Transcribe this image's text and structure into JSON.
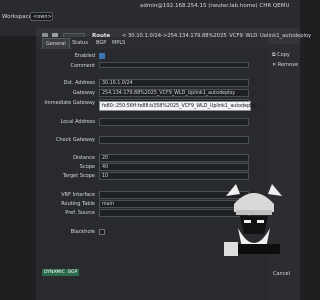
{
  "top": {
    "workspace_label": "Workspace:",
    "workspace_value": "<own>",
    "title": "admin@192.168.254.15 (neuter.lab.home) CHR QEMU"
  },
  "window": {
    "title": "Route",
    "subtitle": "< 30.10.1.0/24->254.134.179.88%2025_VCF9_WLD_Uplink1_autodeploy"
  },
  "tabs": [
    "General",
    "Status",
    "BGP",
    "MPLS"
  ],
  "form": {
    "enabled_label": "Enabled",
    "comment_label": "Comment",
    "dst_address_label": "Dst. Address",
    "dst_address_value": "30.10.1.0/24",
    "gateway_label": "Gateway",
    "gateway_value": "254.134.179.88%2025_VCF9_WLD_Uplink1_autodeploy",
    "immediate_gateway_label": "Immediate Gateway",
    "immediate_gateway_popup": "fe80::250:56ff:fe88:b358%2025_VCF9_WLD_Uplink1_autodeploy",
    "local_address_label": "Local Address",
    "check_gateway_label": "Check Gateway",
    "distance_label": "Distance",
    "distance_value": "20",
    "scope_label": "Scope",
    "scope_value": "40",
    "target_scope_label": "Target Scope",
    "target_scope_value": "10",
    "vrf_interface_label": "VRF Interface",
    "routing_table_label": "Routing Table",
    "routing_table_value": "main",
    "pref_source_label": "Pref. Source",
    "blackhole_label": "Blackhole"
  },
  "side": {
    "copy_label": "Copy",
    "remove_label": "Remove"
  },
  "badges": {
    "dynamic": "DYNAMIC",
    "bgp": "BGP"
  },
  "cancel_label": "Cancel",
  "colors": {
    "badge_green": "#2b6a4a",
    "checkbox_blue": "#3d73b5",
    "background": "#1e1f21"
  }
}
